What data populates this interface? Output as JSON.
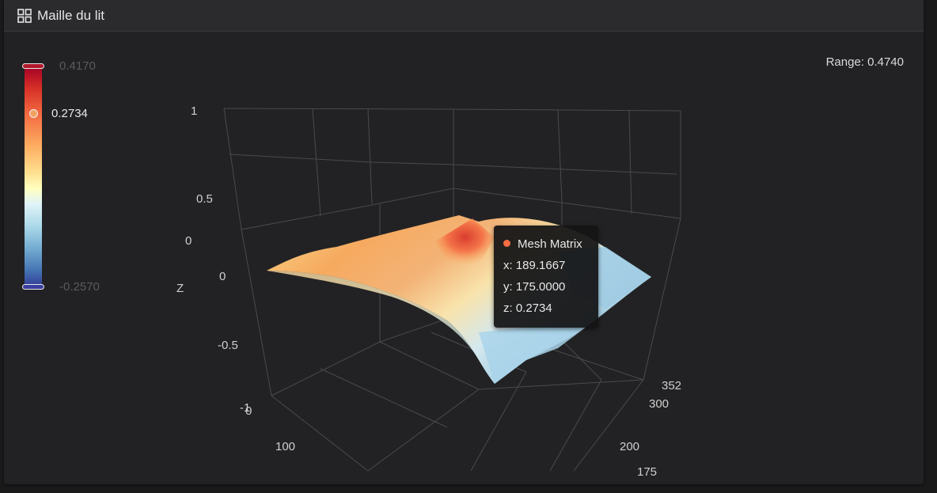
{
  "header": {
    "title": "Maille du lit",
    "icon": "grid-icon"
  },
  "range_label": "Range: 0.4740",
  "color_scale": {
    "max_label": "0.4170",
    "min_label": "-0.2570",
    "current_label": "0.2734",
    "current_value": 0.2734,
    "top_color": "#b2182b",
    "bottom_color": "#3b3fa0"
  },
  "chart_data": {
    "type": "surface",
    "z_ticks": [
      "1",
      "0.5",
      "0",
      "0",
      "-0.5",
      "-1"
    ],
    "z_label": "Z",
    "x_ticks": [
      "0",
      "100"
    ],
    "y_ticks": [
      "175",
      "200",
      "300",
      "352"
    ]
  },
  "tooltip": {
    "series_name": "Mesh Matrix",
    "series_color": "#f46d43",
    "x_text": "x: 189.1667",
    "y_text": "y: 175.0000",
    "z_text": "z: 0.2734"
  }
}
